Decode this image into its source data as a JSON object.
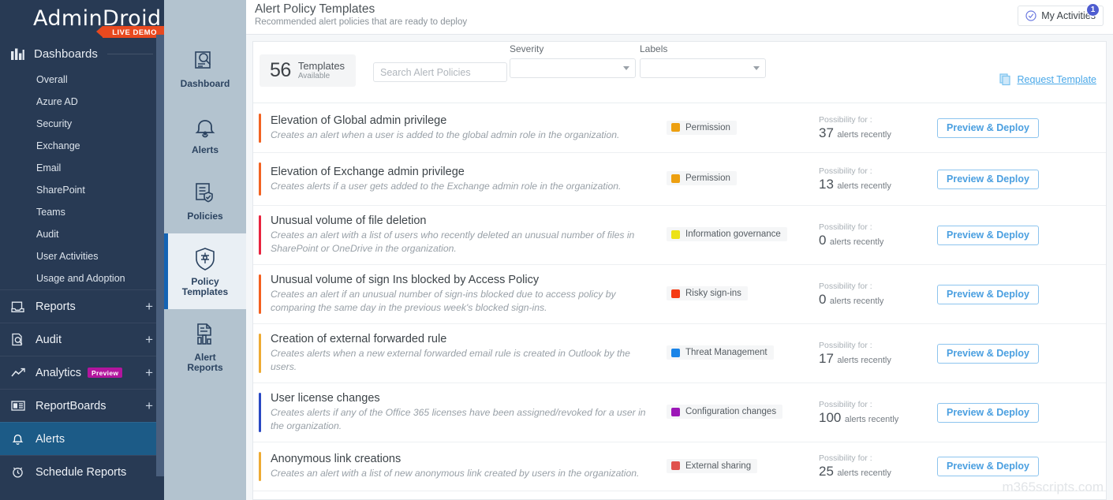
{
  "sidebar": {
    "logo": "AdminDroid",
    "live_demo": "LIVE DEMO",
    "dashboards_head": "Dashboards",
    "dashboard_subitems": [
      {
        "label": "Overall"
      },
      {
        "label": "Azure AD"
      },
      {
        "label": "Security"
      },
      {
        "label": "Exchange"
      },
      {
        "label": "Email"
      },
      {
        "label": "SharePoint"
      },
      {
        "label": "Teams"
      },
      {
        "label": "Audit"
      },
      {
        "label": "User Activities"
      },
      {
        "label": "Usage and Adoption"
      }
    ],
    "items": [
      {
        "label": "Reports",
        "icon": "reports-icon",
        "plus": "+",
        "active": false,
        "badge": ""
      },
      {
        "label": "Audit",
        "icon": "audit-icon",
        "plus": "+",
        "active": false,
        "badge": ""
      },
      {
        "label": "Analytics",
        "icon": "analytics-icon",
        "plus": "+",
        "active": false,
        "badge": "Preview"
      },
      {
        "label": "ReportBoards",
        "icon": "reportboards-icon",
        "plus": "+",
        "active": false,
        "badge": ""
      },
      {
        "label": "Alerts",
        "icon": "bell-icon",
        "plus": "",
        "active": true,
        "badge": ""
      },
      {
        "label": "Schedule Reports",
        "icon": "clock-icon",
        "plus": "",
        "active": false,
        "badge": ""
      }
    ]
  },
  "secnav": {
    "items": [
      {
        "label": "Dashboard",
        "icon": "dashboard-icon",
        "active": false
      },
      {
        "label": "Alerts",
        "icon": "bell-icon",
        "active": false
      },
      {
        "label": "Policies",
        "icon": "policies-icon",
        "active": false
      },
      {
        "label": "Policy\nTemplates",
        "icon": "policy-templates-icon",
        "active": true
      },
      {
        "label": "Alert\nReports",
        "icon": "alert-reports-icon",
        "active": false
      }
    ]
  },
  "header": {
    "title": "Alert Policy Templates",
    "subtitle": "Recommended alert policies that are ready to deploy",
    "my_activities": "My Activities",
    "my_activities_badge": "1"
  },
  "toolbar": {
    "count": "56",
    "count_label": "Templates",
    "count_sub": "Available",
    "search_placeholder": "Search Alert Policies",
    "search_value": "",
    "severity_label": "Severity",
    "severity_value": "",
    "labels_label": "Labels",
    "labels_value": "",
    "request_template": "Request Template"
  },
  "rows": [
    {
      "title": "Elevation of Global admin privilege",
      "desc": "Creates an alert when a user is added to the global admin role in the organization.",
      "bar_color": "#f26322",
      "label": "Permission",
      "label_color": "#eda011",
      "poss_prefix": "Possibility for :",
      "poss_num": "37",
      "poss_unit": "alerts recently",
      "action": "Preview & Deploy"
    },
    {
      "title": "Elevation of Exchange admin privilege",
      "desc": "Creates alerts if a user gets added to the Exchange admin role in the organization.",
      "bar_color": "#f26322",
      "label": "Permission",
      "label_color": "#eda011",
      "poss_prefix": "Possibility for :",
      "poss_num": "13",
      "poss_unit": "alerts recently",
      "action": "Preview & Deploy"
    },
    {
      "title": "Unusual volume of file deletion",
      "desc": "Creates an alert with a list of users who recently deleted an unusual number of files in SharePoint or OneDrive in the organization.",
      "bar_color": "#e8243f",
      "label": "Information governance",
      "label_color": "#ece217",
      "poss_prefix": "Possibility for :",
      "poss_num": "0",
      "poss_unit": "alerts recently",
      "action": "Preview & Deploy"
    },
    {
      "title": "Unusual volume of sign Ins blocked by Access Policy",
      "desc": "Creates an alert if an unusual number of sign-ins blocked due to access policy by comparing the same day in the previous week's blocked sign-ins.",
      "bar_color": "#f4601f",
      "label": "Risky sign-ins",
      "label_color": "#f53b14",
      "poss_prefix": "Possibility for :",
      "poss_num": "0",
      "poss_unit": "alerts recently",
      "action": "Preview & Deploy"
    },
    {
      "title": "Creation of external forwarded rule",
      "desc": "Creates alerts when a new external forwarded email rule is created in Outlook by the users.",
      "bar_color": "#eeab33",
      "label": "Threat Management",
      "label_color": "#1a84e8",
      "poss_prefix": "Possibility for :",
      "poss_num": "17",
      "poss_unit": "alerts recently",
      "action": "Preview & Deploy"
    },
    {
      "title": "User license changes",
      "desc": "Creates alerts if any of the Office 365 licenses have been assigned/revoked for a user in the organization.",
      "bar_color": "#2a49c4",
      "label": "Configuration changes",
      "label_color": "#9c17b8",
      "poss_prefix": "Possibility for :",
      "poss_num": "100",
      "poss_unit": "alerts recently",
      "action": "Preview & Deploy"
    },
    {
      "title": "Anonymous link creations",
      "desc": "Creates an alert with a list of new anonymous link created by users in the organization.",
      "bar_color": "#eeab33",
      "label": "External sharing",
      "label_color": "#e0524d",
      "poss_prefix": "Possibility for :",
      "poss_num": "25",
      "poss_unit": "alerts recently",
      "action": "Preview & Deploy"
    }
  ],
  "watermark": "m365scripts.com",
  "colors": {
    "sidebar_bg": "#283a54",
    "sidebar_active": "#1c5b87",
    "accent_orange": "#e8491f",
    "secnav_bg": "#b3c3cf",
    "secnav_active": "#e9eff4",
    "secnav_marker": "#1463b3",
    "link_blue": "#4aa8e8"
  }
}
